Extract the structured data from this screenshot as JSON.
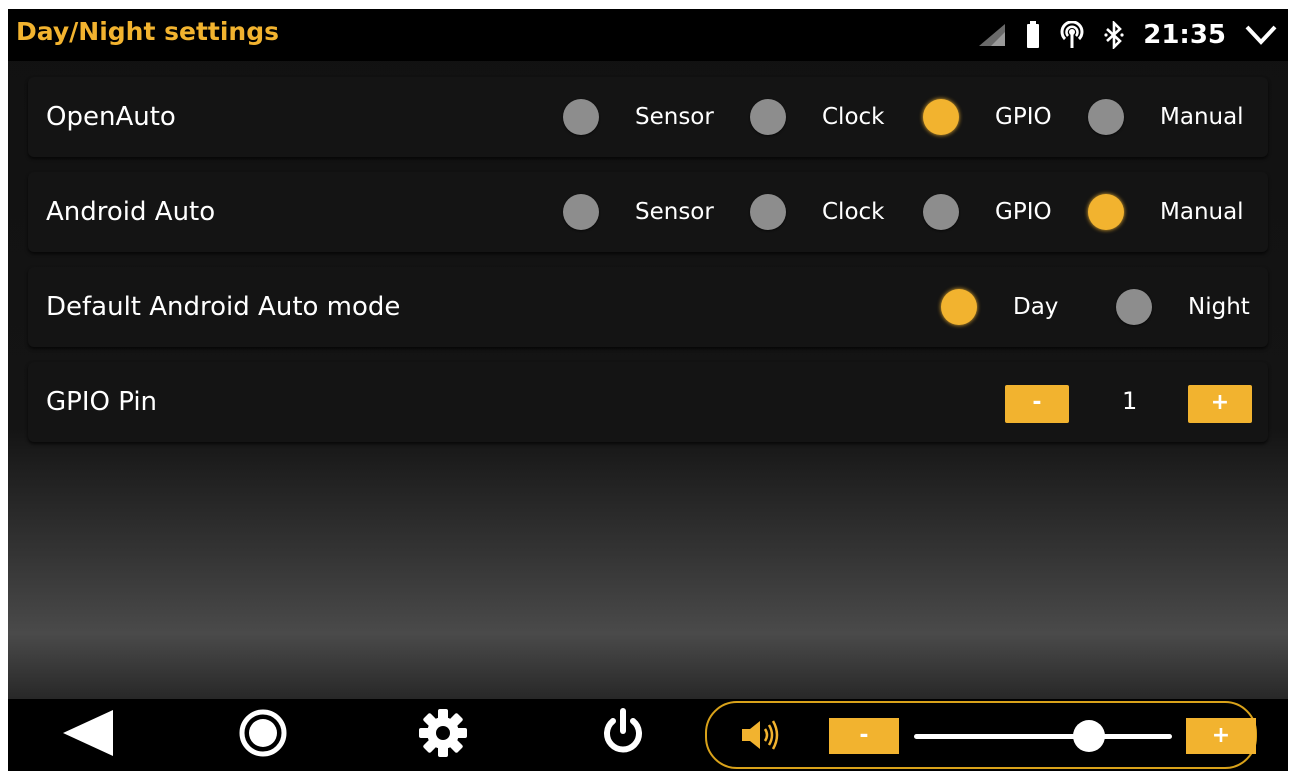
{
  "app": {
    "title": "Day/Night settings"
  },
  "status_bar": {
    "time": "21:35",
    "icons": [
      "signal-icon",
      "battery-icon",
      "hotspot-icon",
      "bluetooth-icon",
      "chevron-down-icon"
    ]
  },
  "rows": {
    "openauto": {
      "label": "OpenAuto",
      "options": [
        "Sensor",
        "Clock",
        "GPIO",
        "Manual"
      ],
      "selected": "GPIO"
    },
    "android_auto": {
      "label": "Android Auto",
      "options": [
        "Sensor",
        "Clock",
        "GPIO",
        "Manual"
      ],
      "selected": "Manual"
    },
    "default_mode": {
      "label": "Default Android Auto mode",
      "options": [
        "Day",
        "Night"
      ],
      "selected": "Day"
    },
    "gpio_pin": {
      "label": "GPIO Pin",
      "value": "1",
      "minus": "-",
      "plus": "+"
    }
  },
  "navbar": {
    "icons": [
      "back-icon",
      "home-icon",
      "settings-icon",
      "power-icon",
      "volume-icon"
    ],
    "volume": {
      "minus": "-",
      "plus": "+",
      "level": 0.68
    }
  },
  "colors": {
    "accent": "#f2b32f",
    "radio_off": "#8d8d8d",
    "panel": "#141414",
    "bar": "#000000"
  }
}
